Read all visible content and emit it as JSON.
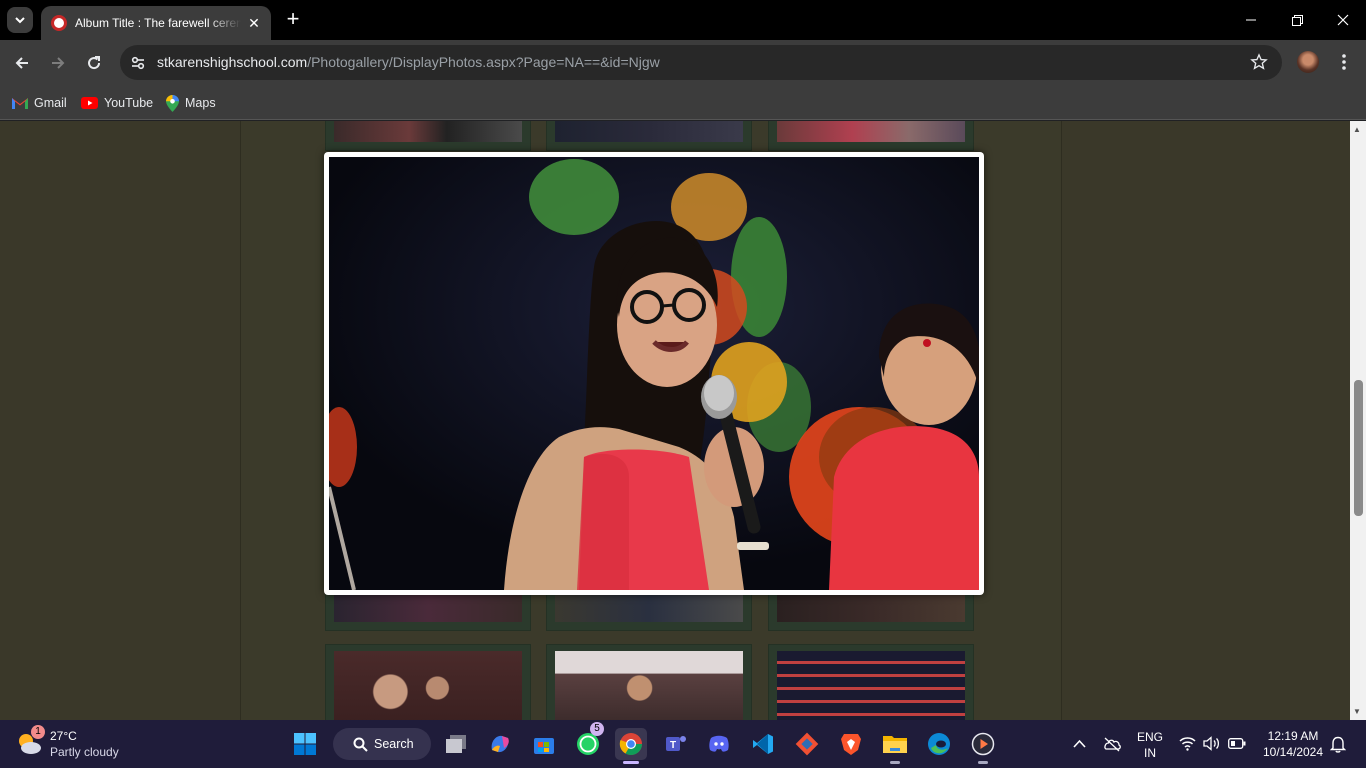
{
  "browser": {
    "tab_title": "Album Title : The farewell ceremony",
    "url_host": "stkarenshighschool.com",
    "url_path": "/Photogallery/DisplayPhotos.aspx?Page=NA==&id=Njgw",
    "bookmarks": [
      {
        "label": "Gmail",
        "icon": "gmail-icon"
      },
      {
        "label": "YouTube",
        "icon": "youtube-icon"
      },
      {
        "label": "Maps",
        "icon": "maps-icon"
      }
    ]
  },
  "lightbox": {
    "photo_subject": "student-singing-with-microphone"
  },
  "taskbar": {
    "weather": {
      "temp": "27°C",
      "desc": "Partly cloudy",
      "badge": "1"
    },
    "search_label": "Search",
    "whatsapp_badge": "5",
    "lang_line1": "ENG",
    "lang_line2": "IN",
    "time": "12:19 AM",
    "date": "10/14/2024"
  },
  "colors": {
    "page_bg": "#3a3829",
    "thumb_frame": "#2b3a2c",
    "taskbar": "#1f1c3a",
    "chrome_dark": "#3c3c3c"
  }
}
